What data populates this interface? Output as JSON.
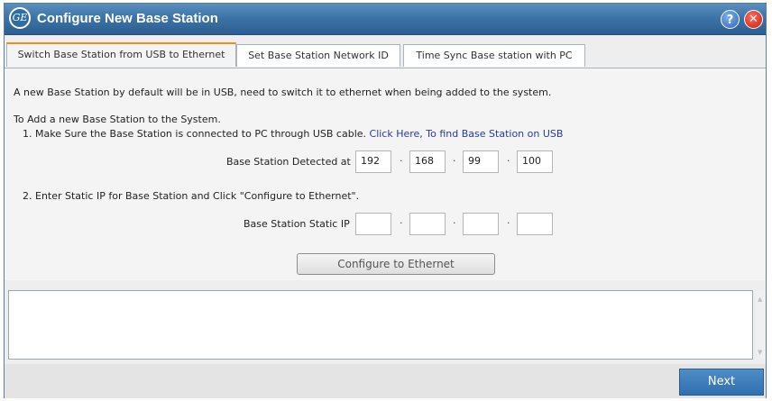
{
  "window": {
    "title": "Configure New Base Station",
    "logo_text": "GE",
    "help_icon": "question-mark",
    "close_icon": "x"
  },
  "tabs": [
    {
      "label": "Switch Base Station from USB to Ethernet",
      "active": true
    },
    {
      "label": "Set Base Station Network ID",
      "active": false
    },
    {
      "label": "Time Sync Base station with PC",
      "active": false
    }
  ],
  "content": {
    "intro": "A new Base Station by default will be in USB, need to switch it to ethernet when being added to the system.",
    "section_heading": "To Add a new Base Station to the System.",
    "step1_text": "1. Make Sure the Base Station is connected to PC through USB cable.",
    "step1_link": "Click Here, To find Base Station on USB",
    "detected_label": "Base Station Detected at",
    "detected_ip": [
      "192",
      "168",
      "99",
      "100"
    ],
    "step2_text": "2. Enter Static IP for Base Station and Click \"Configure to Ethernet\".",
    "static_label": "Base Station Static IP",
    "static_ip": [
      "",
      "",
      "",
      ""
    ],
    "separator": "·",
    "configure_button": "Configure to Ethernet"
  },
  "log": {
    "text": ""
  },
  "footer": {
    "next_button": "Next"
  },
  "colors": {
    "titlebar": "#3c74a8",
    "active_tab_accent": "#f28c1a",
    "link": "#2a3a9a",
    "next_button": "#3a7bbd"
  }
}
